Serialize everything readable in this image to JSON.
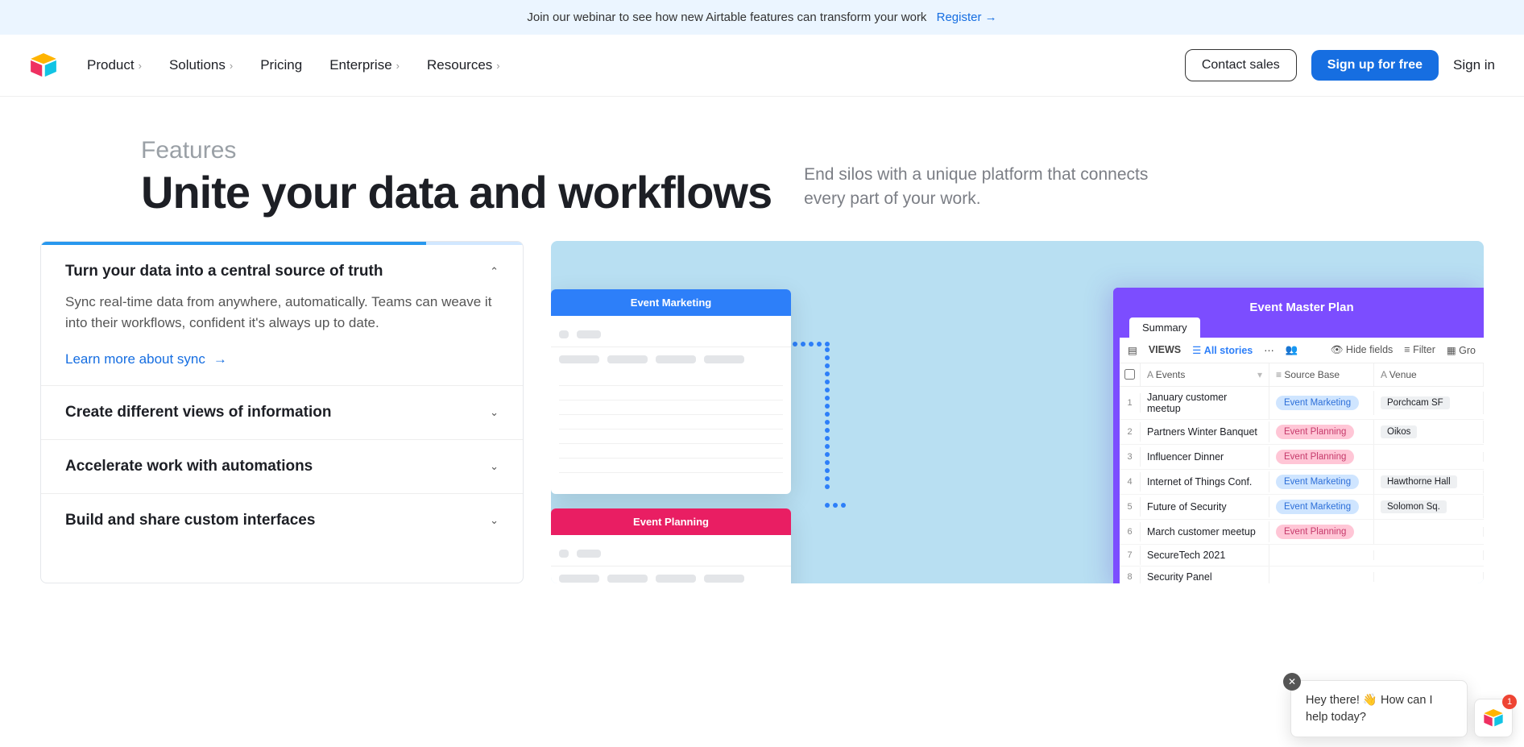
{
  "banner": {
    "text": "Join our webinar to see how new Airtable features can transform your work",
    "link": "Register"
  },
  "nav": {
    "items": [
      "Product",
      "Solutions",
      "Pricing",
      "Enterprise",
      "Resources"
    ],
    "has_chevron": [
      true,
      true,
      false,
      true,
      true
    ],
    "contact": "Contact sales",
    "signup": "Sign up for free",
    "signin": "Sign in"
  },
  "hero": {
    "eyebrow": "Features",
    "title": "Unite your data and workflows",
    "sub": "End silos with a unique platform that connects every part of your work."
  },
  "accordion": [
    {
      "title": "Turn your data into a central source of truth",
      "open": true,
      "body": "Sync real-time data from anywhere, automatically. Teams can weave it into their workflows, confident it's always up to date.",
      "link": "Learn more about sync"
    },
    {
      "title": "Create different views of information",
      "open": false
    },
    {
      "title": "Accelerate work with automations",
      "open": false
    },
    {
      "title": "Build and share custom interfaces",
      "open": false
    }
  ],
  "preview": {
    "mini1_title": "Event Marketing",
    "mini2_title": "Event Planning",
    "big_title": "Event Master Plan",
    "big_tab": "Summary",
    "views_label": "VIEWS",
    "all_stories": "All stories",
    "hide_fields": "Hide fields",
    "filter": "Filter",
    "group": "Gro",
    "columns": [
      "Events",
      "Source Base",
      "Venue"
    ],
    "rows": [
      {
        "n": "1",
        "event": "January customer meetup",
        "src": "Event Marketing",
        "src_color": "blue",
        "venue": "Porchcam SF"
      },
      {
        "n": "2",
        "event": "Partners Winter Banquet",
        "src": "Event Planning",
        "src_color": "pink",
        "venue": "Oikos"
      },
      {
        "n": "3",
        "event": "Influencer Dinner",
        "src": "Event Planning",
        "src_color": "pink",
        "venue": ""
      },
      {
        "n": "4",
        "event": "Internet of Things Conf.",
        "src": "Event Marketing",
        "src_color": "blue",
        "venue": "Hawthorne Hall"
      },
      {
        "n": "5",
        "event": "Future of Security",
        "src": "Event Marketing",
        "src_color": "blue",
        "venue": "Solomon Sq."
      },
      {
        "n": "6",
        "event": "March customer meetup",
        "src": "Event Planning",
        "src_color": "pink",
        "venue": ""
      },
      {
        "n": "7",
        "event": "SecureTech 2021",
        "src": "",
        "src_color": "",
        "venue": ""
      },
      {
        "n": "8",
        "event": "Security Panel",
        "src": "",
        "src_color": "",
        "venue": ""
      }
    ]
  },
  "chat": {
    "text_a": "Hey there! ",
    "text_b": "How can I help today?",
    "badge": "1"
  }
}
